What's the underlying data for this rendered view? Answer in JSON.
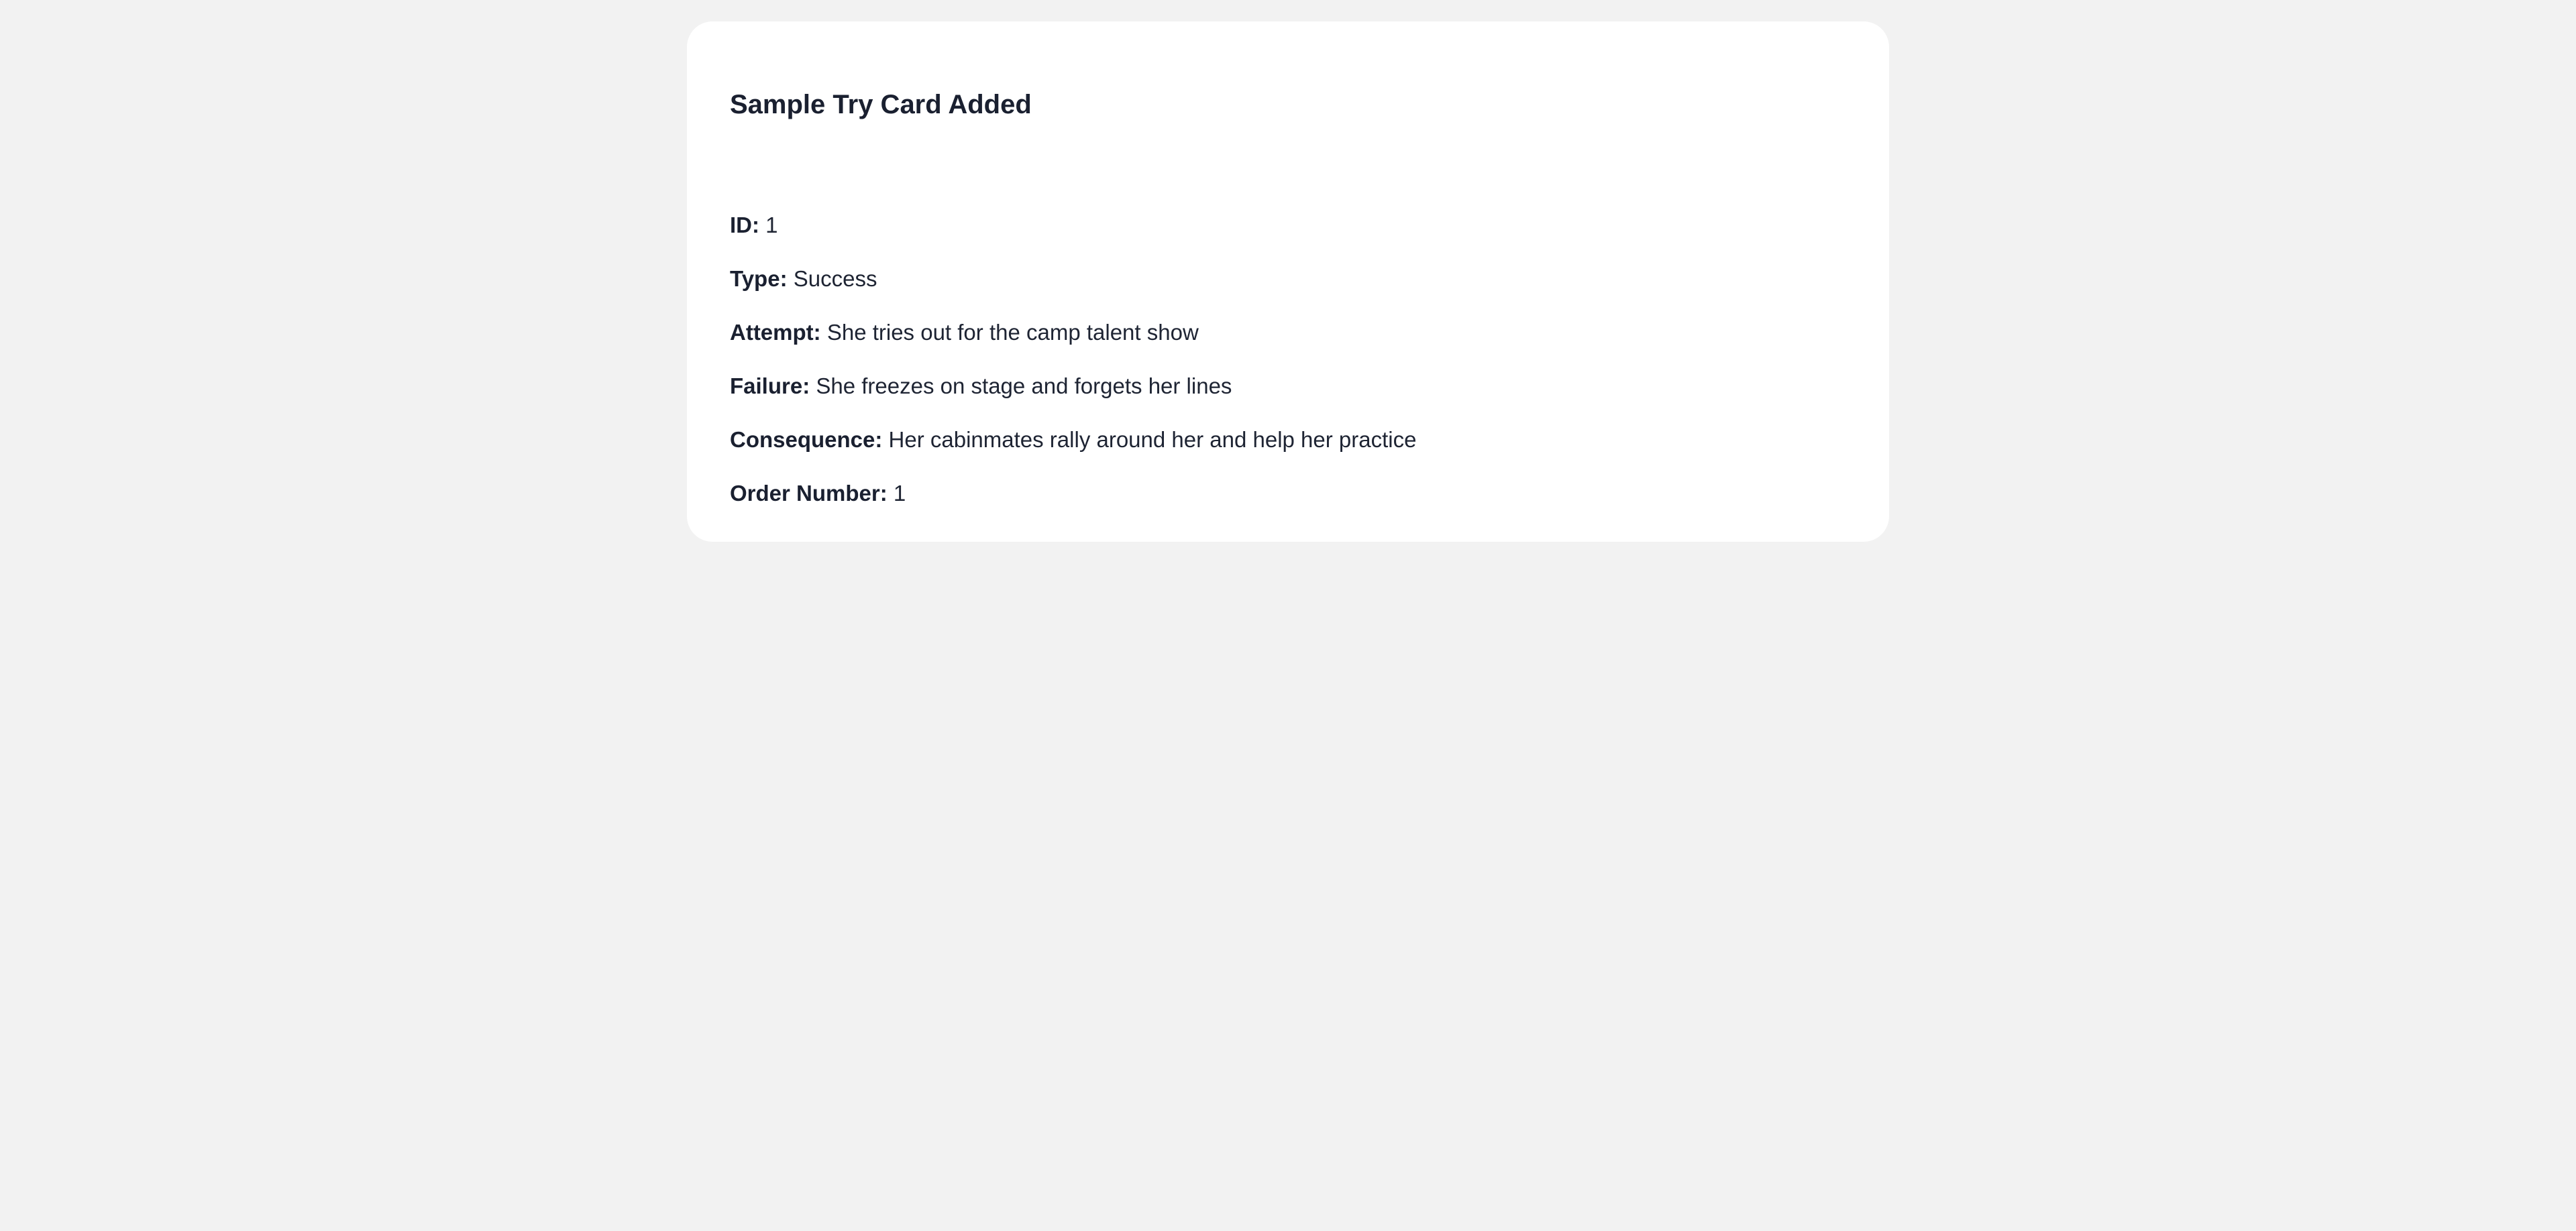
{
  "card": {
    "title": "Sample Try Card Added",
    "fields": [
      {
        "label": "ID:",
        "value": "1"
      },
      {
        "label": "Type:",
        "value": "Success"
      },
      {
        "label": "Attempt:",
        "value": "She tries out for the camp talent show"
      },
      {
        "label": "Failure:",
        "value": "She freezes on stage and forgets her lines"
      },
      {
        "label": "Consequence:",
        "value": "Her cabinmates rally around her and help her practice"
      },
      {
        "label": "Order Number:",
        "value": "1"
      }
    ]
  },
  "colors": {
    "page_background": "#f2f2f2",
    "card_background": "#ffffff",
    "text": "#1e2433"
  }
}
